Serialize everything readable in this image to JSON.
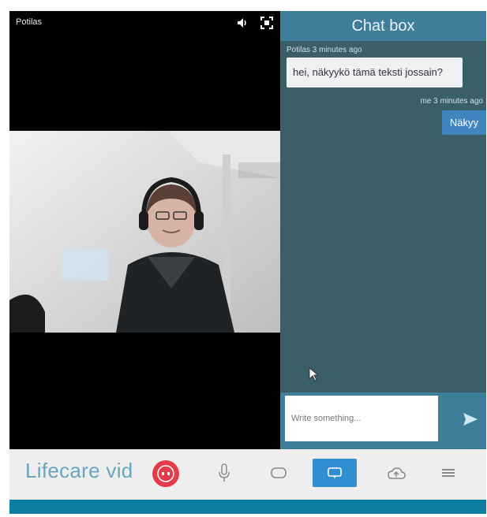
{
  "video": {
    "caller_name": "Potilas",
    "icons": {
      "speaker": "speaker-icon",
      "fullscreen": "fullscreen-icon"
    }
  },
  "chat": {
    "title": "Chat box",
    "messages": [
      {
        "meta": "Potilas 3 minutes ago",
        "text": "hei, näkyykö tämä teksti jossain?",
        "direction": "in"
      },
      {
        "meta": "me 3 minutes ago",
        "text": "Näkyy",
        "direction": "out"
      }
    ],
    "input_placeholder": "Write something...",
    "icons": {
      "send": "send-icon",
      "cursor": "pointer-icon"
    }
  },
  "toolbar": {
    "brand_text": "Lifecare vid",
    "badge_icon": "hangup-icon",
    "tools": [
      {
        "name": "microphone",
        "icon": "microphone-icon"
      },
      {
        "name": "camera",
        "icon": "camera-icon"
      },
      {
        "name": "chat",
        "icon": "chat-icon",
        "active": true
      },
      {
        "name": "upload",
        "icon": "cloud-upload-icon"
      },
      {
        "name": "menu",
        "icon": "menu-icon"
      }
    ]
  },
  "colors": {
    "chat_bg": "#3a5f68",
    "header_bg": "#3f7e98",
    "accent_blue": "#2f8fd1",
    "out_bubble": "#3f86c1",
    "brand_text": "#6aa5bf",
    "badge_red": "#e33b4a",
    "bottom_bar": "#0b7ea1"
  }
}
